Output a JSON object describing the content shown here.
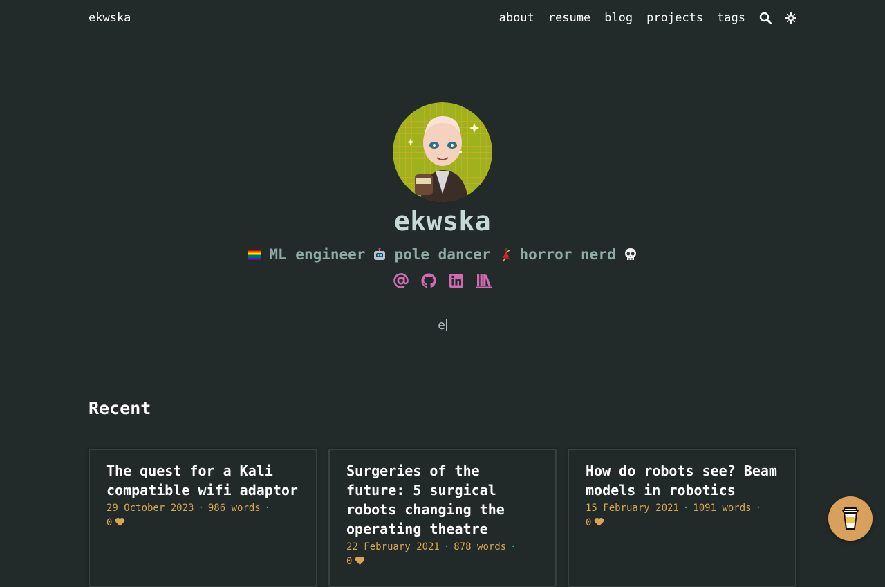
{
  "header": {
    "brand": "ekwska",
    "nav": [
      "about",
      "resume",
      "blog",
      "projects",
      "tags"
    ],
    "icons": [
      "search-icon",
      "theme-toggle-icon"
    ]
  },
  "hero": {
    "name": "ekwska",
    "tagline": {
      "part1": "ML engineer",
      "part2": "pole dancer",
      "part3": "horror nerd"
    },
    "socials": [
      "email-icon",
      "github-icon",
      "linkedin-icon",
      "library-icon"
    ],
    "typed_text": "e"
  },
  "recent": {
    "title": "Recent",
    "cards": [
      {
        "title": "The quest for a Kali compatible wifi adaptor",
        "date": "29 October 2023",
        "words": "986 words",
        "likes": "0"
      },
      {
        "title": "Surgeries of the future: 5 surgical robots changing the operating theatre",
        "date": "22 February 2021",
        "words": "878 words",
        "likes": "0"
      },
      {
        "title": "How do robots see? Beam models in robotics",
        "date": "15 February 2021",
        "words": "1091 words",
        "likes": "0"
      }
    ]
  },
  "colors": {
    "background": "#222b2a",
    "accent_pink": "#d06ab3",
    "meta_orange": "#d8a653",
    "dot_teal": "#3fbfb0"
  }
}
